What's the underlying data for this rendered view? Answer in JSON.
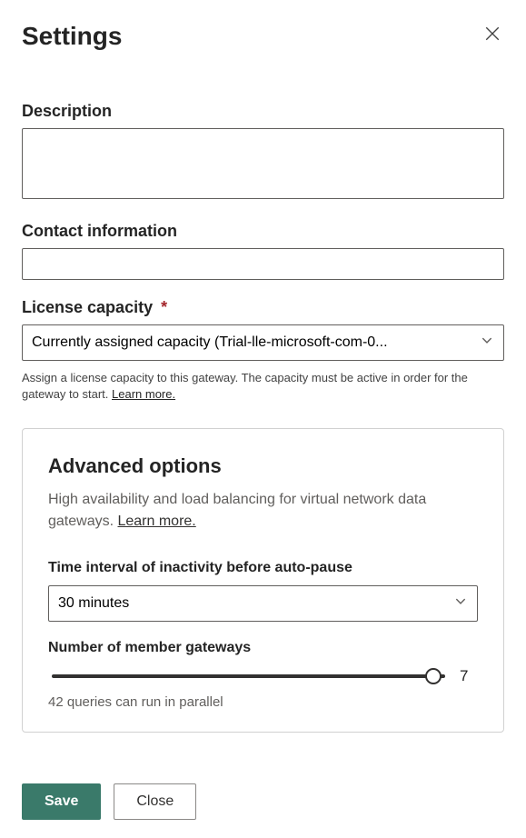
{
  "header": {
    "title": "Settings"
  },
  "description": {
    "label": "Description",
    "value": ""
  },
  "contact": {
    "label": "Contact information",
    "value": ""
  },
  "license": {
    "label": "License capacity",
    "required_marker": "*",
    "selected": "Currently assigned capacity (Trial-lle-microsoft-com-0...",
    "help_text": "Assign a license capacity to this gateway. The capacity must be active in order for the gateway to start. ",
    "learn_more": "Learn more."
  },
  "advanced": {
    "title": "Advanced options",
    "description": "High availability and load balancing for virtual network data gateways. ",
    "learn_more": "Learn more.",
    "time_interval": {
      "label": "Time interval of inactivity before auto-pause",
      "selected": "30 minutes"
    },
    "members": {
      "label": "Number of member gateways",
      "value": "7",
      "thumb_percent": 97,
      "caption": "42 queries can run in parallel"
    }
  },
  "footer": {
    "save": "Save",
    "close": "Close"
  }
}
